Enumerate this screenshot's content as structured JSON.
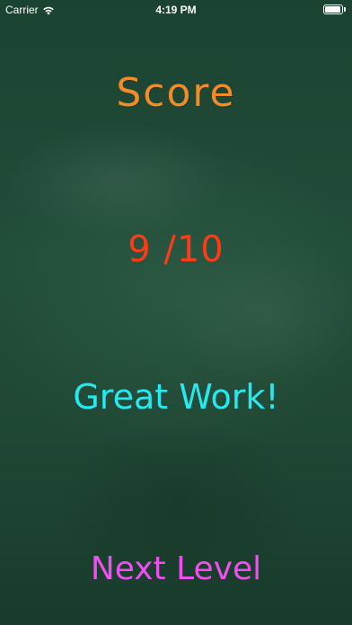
{
  "status_bar": {
    "carrier": "Carrier",
    "time": "4:19 PM",
    "wifi_icon": "wifi-icon",
    "battery_icon": "battery-icon"
  },
  "score": {
    "title": "Score",
    "value": "9 /10"
  },
  "message": "Great Work!",
  "next_button_label": "Next Level",
  "colors": {
    "background": "#1f4a36",
    "title": "#f28c28",
    "score": "#ff3a16",
    "message": "#27e8ee",
    "button": "#f04ff0"
  }
}
